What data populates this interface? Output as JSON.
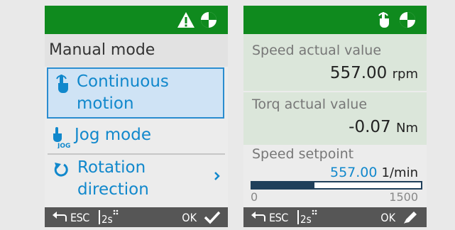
{
  "left_panel": {
    "title": "Manual mode",
    "menu_items": [
      {
        "label_line1": "Continuous",
        "label_line2": "motion",
        "icon": "hand-touch-icon",
        "selected": true
      },
      {
        "label": "Jog mode",
        "icon": "jog-hand-icon"
      },
      {
        "label_line1": "Rotation",
        "label_line2": "direction",
        "icon": "rotation-icon",
        "has_submenu": true
      }
    ],
    "header_icons": [
      "warning-icon",
      "status-circle-icon"
    ],
    "footer": {
      "esc": "ESC",
      "hold": "2s",
      "ok": "OK",
      "ok_icon": "check-icon"
    }
  },
  "right_panel": {
    "header_icons": [
      "hand-touch-icon",
      "status-circle-icon"
    ],
    "speed_actual": {
      "label": "Speed actual value",
      "value": "557.00",
      "unit": "rpm"
    },
    "torque_actual": {
      "label": "Torq actual value",
      "value": "-0.07",
      "unit": "Nm"
    },
    "setpoint": {
      "label": "Speed setpoint",
      "value": "557.00",
      "unit": "1/min",
      "min": "0",
      "max": "1500",
      "fill_fraction": 0.37
    },
    "footer": {
      "esc": "ESC",
      "hold": "2s",
      "ok": "OK",
      "ok_icon": "pencil-icon"
    }
  },
  "colors": {
    "header_green": "#0f8a1e",
    "accent_blue": "#1188cc",
    "footer_grey": "#565656"
  }
}
